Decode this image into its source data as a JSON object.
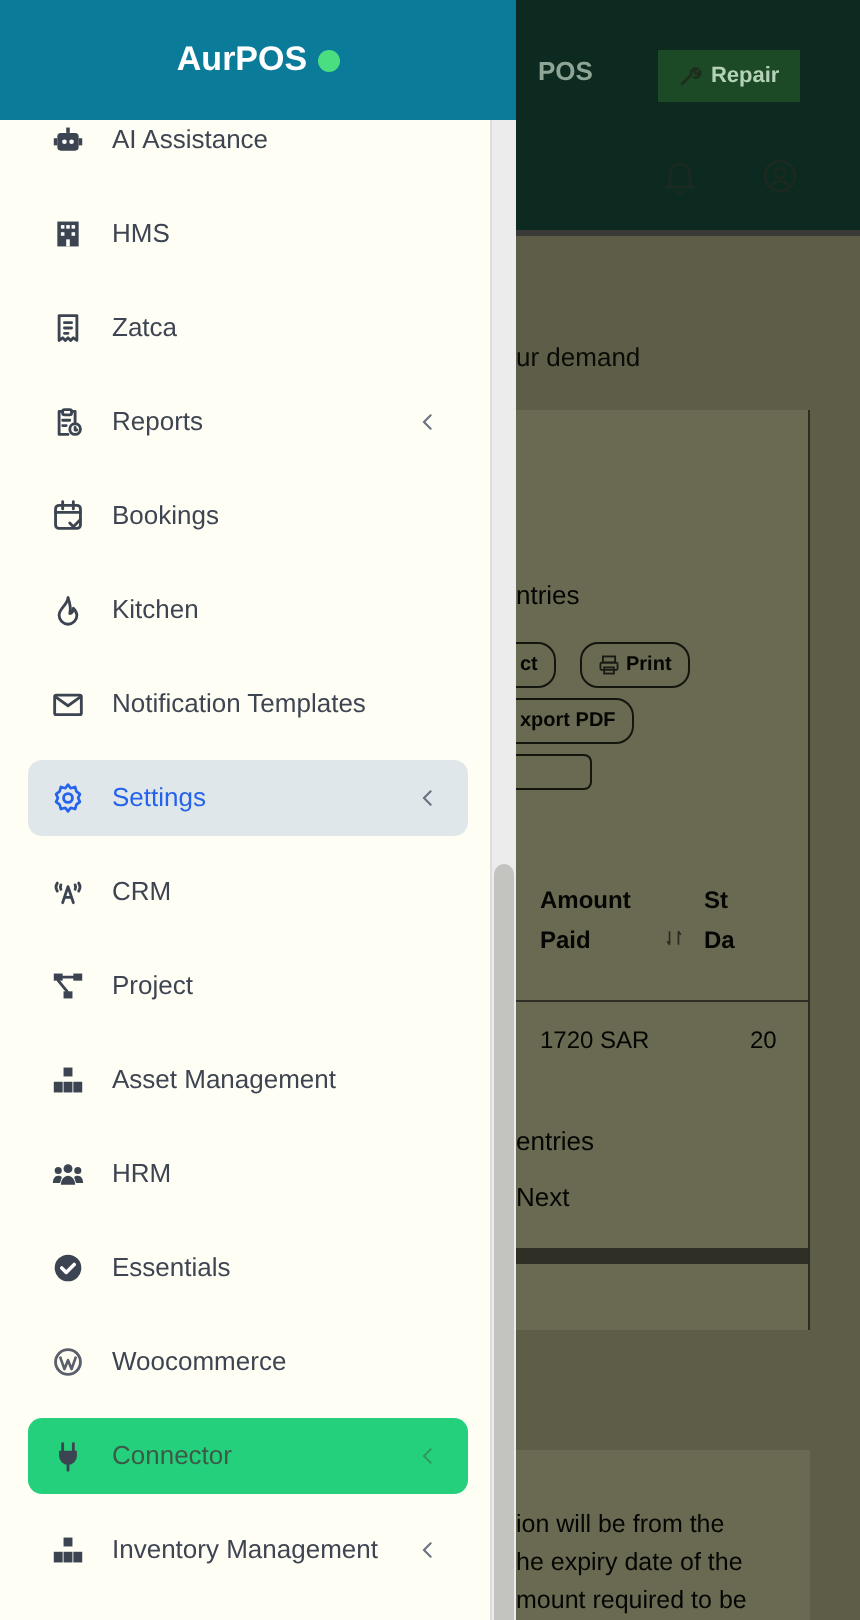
{
  "sidebar": {
    "brand": "AurPOS",
    "online": true,
    "items": [
      {
        "label": "AI Assistance",
        "selected": false,
        "hovered": false,
        "has_submenu": false
      },
      {
        "label": "HMS",
        "selected": false,
        "hovered": false,
        "has_submenu": false
      },
      {
        "label": "Zatca",
        "selected": false,
        "hovered": false,
        "has_submenu": false
      },
      {
        "label": "Reports",
        "selected": false,
        "hovered": false,
        "has_submenu": true
      },
      {
        "label": "Bookings",
        "selected": false,
        "hovered": false,
        "has_submenu": false
      },
      {
        "label": "Kitchen",
        "selected": false,
        "hovered": false,
        "has_submenu": false
      },
      {
        "label": "Notification Templates",
        "selected": false,
        "hovered": false,
        "has_submenu": false
      },
      {
        "label": "Settings",
        "selected": false,
        "hovered": true,
        "has_submenu": true
      },
      {
        "label": "CRM",
        "selected": false,
        "hovered": false,
        "has_submenu": false
      },
      {
        "label": "Project",
        "selected": false,
        "hovered": false,
        "has_submenu": false
      },
      {
        "label": "Asset Management",
        "selected": false,
        "hovered": false,
        "has_submenu": false
      },
      {
        "label": "HRM",
        "selected": false,
        "hovered": false,
        "has_submenu": false
      },
      {
        "label": "Essentials",
        "selected": false,
        "hovered": false,
        "has_submenu": false
      },
      {
        "label": "Woocommerce",
        "selected": false,
        "hovered": false,
        "has_submenu": false
      },
      {
        "label": "Connector",
        "selected": true,
        "hovered": false,
        "has_submenu": true
      },
      {
        "label": "Inventory Management",
        "selected": false,
        "hovered": false,
        "has_submenu": true
      }
    ]
  },
  "main": {
    "topbar": {
      "title": "POS",
      "repair_button": "Repair"
    },
    "subtitle": "ur demand",
    "panel": {
      "entries_label": "ntries",
      "buttons": [
        "ct",
        "Print",
        "xport PDF"
      ],
      "table": {
        "columns": [
          "Amount Paid",
          "St Da"
        ],
        "rows": [
          [
            "1720 SAR",
            "20"
          ]
        ]
      },
      "footer_entries": "entries",
      "next_button": "Next"
    },
    "note": "ion will be from the\nhe expiry date of the\nmount required to be"
  }
}
